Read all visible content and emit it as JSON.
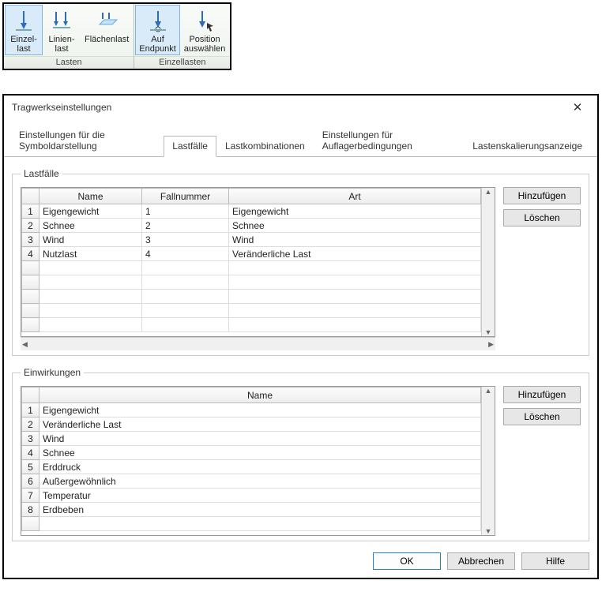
{
  "ribbon": {
    "groups": [
      {
        "label": "Lasten",
        "items": [
          {
            "label": "Einzel-\nlast",
            "selected": true
          },
          {
            "label": "Linien-\nlast",
            "selected": false
          },
          {
            "label": "Flächenlast",
            "selected": false
          }
        ]
      },
      {
        "label": "Einzellasten",
        "items": [
          {
            "label": "Auf\nEndpunkt",
            "selected": true
          },
          {
            "label": "Position\nauswählen",
            "selected": false
          }
        ]
      }
    ]
  },
  "dialog": {
    "title": "Tragwerkseinstellungen",
    "tabs": [
      "Einstellungen für die Symboldarstellung",
      "Lastfälle",
      "Lastkombinationen",
      "Einstellungen für Auflagerbedingungen",
      "Lastenskalierungsanzeige"
    ],
    "tabs_active": 1,
    "buttons": {
      "add": "Hinzufügen",
      "del": "Löschen",
      "ok": "OK",
      "cancel": "Abbrechen",
      "help": "Hilfe"
    }
  },
  "lastfaelle": {
    "legend": "Lastfälle",
    "columns": [
      "",
      "Name",
      "Fallnummer",
      "Art"
    ],
    "rows": [
      {
        "n": "1",
        "name": "Eigengewicht",
        "num": "1",
        "art": "Eigengewicht"
      },
      {
        "n": "2",
        "name": "Schnee",
        "num": "2",
        "art": "Schnee"
      },
      {
        "n": "3",
        "name": "Wind",
        "num": "3",
        "art": "Wind"
      },
      {
        "n": "4",
        "name": "Nutzlast",
        "num": "4",
        "art": "Veränderliche Last"
      }
    ]
  },
  "einwirkungen": {
    "legend": "Einwirkungen",
    "columns": [
      "",
      "Name"
    ],
    "rows": [
      {
        "n": "1",
        "name": "Eigengewicht"
      },
      {
        "n": "2",
        "name": "Veränderliche Last"
      },
      {
        "n": "3",
        "name": "Wind"
      },
      {
        "n": "4",
        "name": "Schnee"
      },
      {
        "n": "5",
        "name": "Erddruck"
      },
      {
        "n": "6",
        "name": "Außergewöhnlich"
      },
      {
        "n": "7",
        "name": "Temperatur"
      },
      {
        "n": "8",
        "name": "Erdbeben"
      }
    ]
  }
}
